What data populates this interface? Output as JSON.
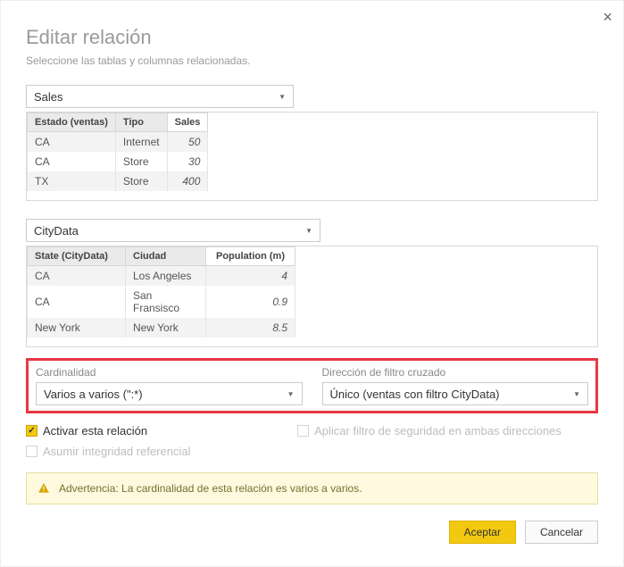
{
  "title": "Editar relación",
  "subtitle": "Seleccione las tablas y columnas relacionadas.",
  "close_label": "×",
  "table1": {
    "dropdown": "Sales",
    "cols": [
      "Estado (ventas)",
      "Tipo",
      "Sales"
    ],
    "highlight_col": 2,
    "rows": [
      [
        "CA",
        "Internet",
        "50"
      ],
      [
        "CA",
        "Store",
        "30"
      ],
      [
        "TX",
        "Store",
        "400"
      ]
    ]
  },
  "table2": {
    "dropdown": "CityData",
    "cols": [
      "State (CityData)",
      "Ciudad",
      "Population (m)"
    ],
    "highlight_col": 2,
    "rows": [
      [
        "CA",
        "Los Angeles",
        "4"
      ],
      [
        "CA",
        "San Fransisco",
        "0.9"
      ],
      [
        "New York",
        "New York",
        "8.5"
      ]
    ]
  },
  "cardinality": {
    "label": "Cardinalidad",
    "value": "Varios a varios (\":*)"
  },
  "crossfilter": {
    "label": "Dirección de filtro cruzado",
    "value": "Único (ventas con filtro CityData)"
  },
  "checks": {
    "activate": "Activar esta relación",
    "security": "Aplicar filtro de seguridad en ambas direcciones",
    "integrity": "Asumir integridad referencial"
  },
  "warning": "Advertencia: La cardinalidad de esta relación es varios a varios.",
  "buttons": {
    "ok": "Aceptar",
    "cancel": "Cancelar"
  }
}
